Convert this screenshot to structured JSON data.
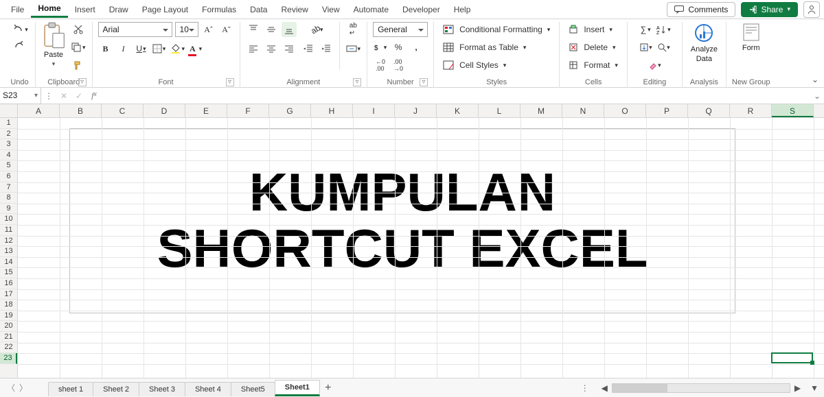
{
  "menu": {
    "items": [
      "File",
      "Home",
      "Insert",
      "Draw",
      "Page Layout",
      "Formulas",
      "Data",
      "Review",
      "View",
      "Automate",
      "Developer",
      "Help"
    ],
    "active": 1,
    "comments": "Comments",
    "share": "Share"
  },
  "ribbon": {
    "undo": "Undo",
    "clipboard": {
      "label": "Clipboard",
      "paste": "Paste"
    },
    "font": {
      "label": "Font",
      "name": "Arial",
      "size": "10",
      "bold": "B",
      "italic": "I",
      "underline": "U",
      "grow": "Aˆ",
      "shrink": "Aˇ"
    },
    "alignment": {
      "label": "Alignment"
    },
    "number": {
      "label": "Number",
      "format": "General",
      "percent": "%"
    },
    "styles": {
      "label": "Styles",
      "cond": "Conditional Formatting",
      "table": "Format as Table",
      "cell": "Cell Styles"
    },
    "cells": {
      "label": "Cells",
      "insert": "Insert",
      "delete": "Delete",
      "format": "Format"
    },
    "editing": {
      "label": "Editing",
      "sum": "∑"
    },
    "analysis": {
      "label": "Analysis",
      "analyze": "Analyze",
      "data": "Data"
    },
    "newgroup": {
      "label": "New Group",
      "form": "Form"
    }
  },
  "fx": {
    "cell": "S23",
    "formula": ""
  },
  "grid": {
    "cols": [
      "A",
      "B",
      "C",
      "D",
      "E",
      "F",
      "G",
      "H",
      "I",
      "J",
      "K",
      "L",
      "M",
      "N",
      "O",
      "P",
      "Q",
      "R",
      "S"
    ],
    "rows": 23,
    "active": {
      "col": 18,
      "row": 22
    },
    "textbox": {
      "line1": "KUMPULAN",
      "line2": "SHORTCUT EXCEL"
    }
  },
  "sheets": {
    "tabs": [
      "sheet 1",
      "Sheet 2",
      "Sheet 3",
      "Sheet 4",
      "Sheet5",
      "Sheet1"
    ],
    "active": 5
  }
}
